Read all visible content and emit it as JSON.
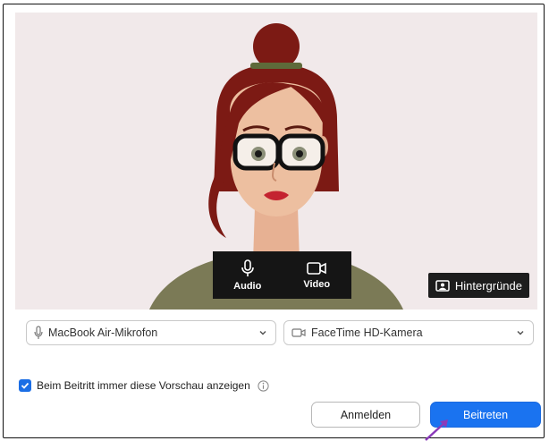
{
  "preview": {
    "audio_label": "Audio",
    "video_label": "Video",
    "backgrounds_label": "Hintergründe"
  },
  "devices": {
    "microphone": "MacBook Air-Mikrofon",
    "camera": "FaceTime HD-Kamera"
  },
  "options": {
    "always_show_preview": "Beim Beitritt immer diese Vorschau anzeigen",
    "always_show_preview_checked": true
  },
  "buttons": {
    "sign_in": "Anmelden",
    "join": "Beitreten"
  },
  "colors": {
    "accent": "#1a73f0",
    "pointer": "#8a3ab9",
    "preview_bg": "#f1e9ea"
  },
  "icons": [
    "microphone-icon",
    "camera-icon",
    "background-image-icon",
    "chevron-down-icon",
    "checkmark-icon",
    "info-icon"
  ]
}
